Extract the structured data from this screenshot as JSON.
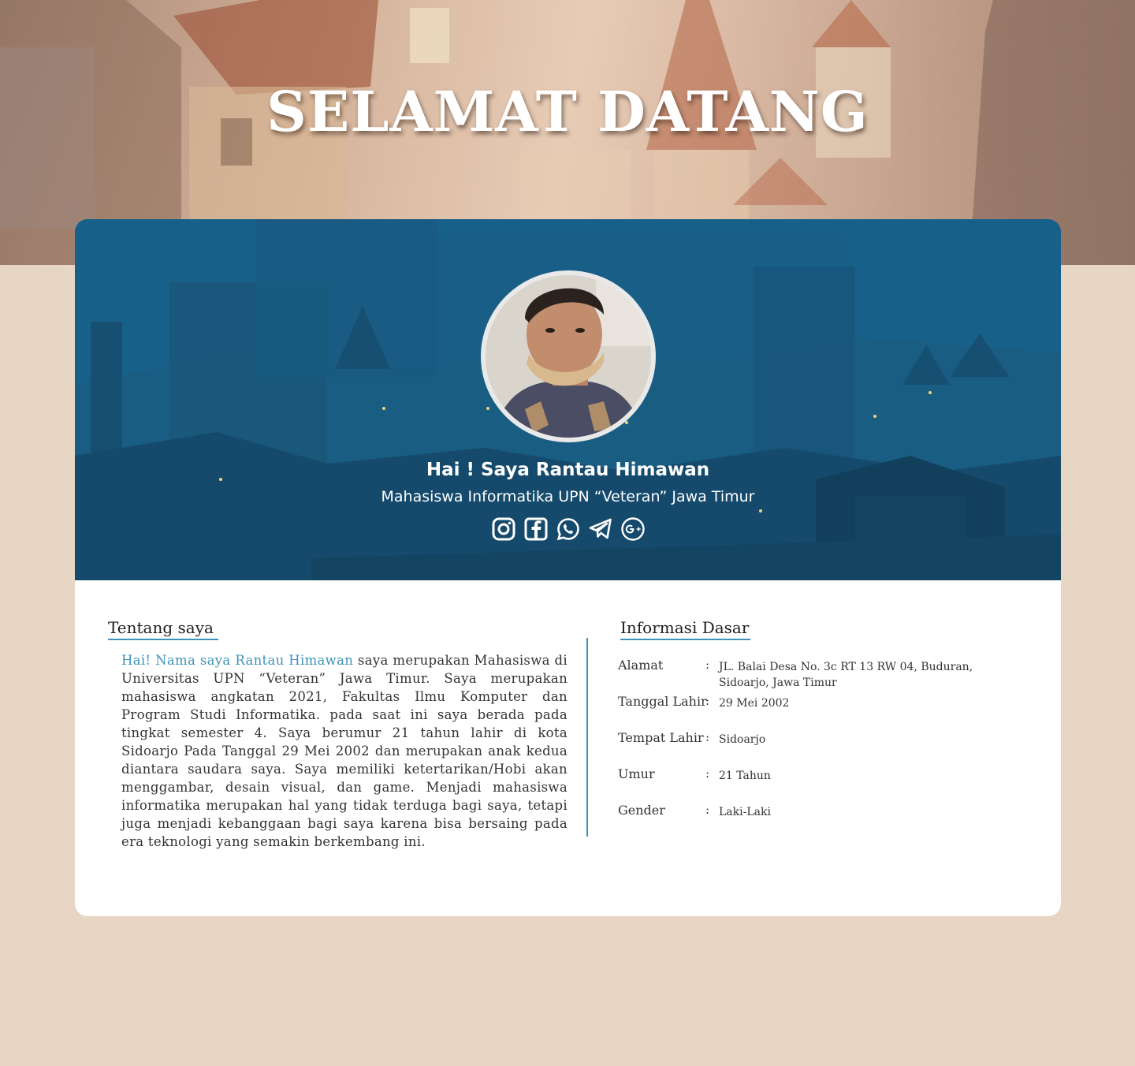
{
  "hero": {
    "title": "SELAMAT DATANG"
  },
  "profile": {
    "name": "Hai ! Saya Rantau Himawan",
    "role": "Mahasiswa Informatika UPN “Veteran” Jawa Timur",
    "socials": [
      {
        "icon": "instagram-icon"
      },
      {
        "icon": "facebook-icon"
      },
      {
        "icon": "whatsapp-icon"
      },
      {
        "icon": "telegram-icon"
      },
      {
        "icon": "google-plus-icon"
      }
    ]
  },
  "about": {
    "title": "Tentang saya",
    "highlight": "Hai! Nama saya Rantau Himawan",
    "text": " saya merupakan Mahasiswa di Universitas UPN “Veteran” Jawa Timur. Saya merupakan mahasiswa angkatan 2021, Fakultas Ilmu Komputer dan Program Studi Informatika. pada saat ini saya berada pada tingkat semester 4. Saya berumur 21 tahun lahir di kota Sidoarjo Pada Tanggal 29 Mei 2002 dan merupakan anak kedua diantara saudara saya. Saya memiliki ketertarikan/Hobi akan menggambar, desain visual, dan game. Menjadi mahasiswa informatika merupakan hal yang tidak terduga bagi saya, tetapi juga menjadi kebanggaan bagi saya karena bisa bersaing pada era teknologi yang semakin berkembang ini."
  },
  "info": {
    "title": "Informasi Dasar",
    "rows": [
      {
        "label": "Alamat",
        "value": "JL. Balai Desa No. 3c RT 13 RW 04, Buduran, Sidoarjo, Jawa Timur"
      },
      {
        "label": "Tanggal Lahir",
        "value": "29 Mei 2002"
      },
      {
        "label": "Tempat Lahir",
        "value": "Sidoarjo"
      },
      {
        "label": "Umur",
        "value": "21 Tahun"
      },
      {
        "label": "Gender",
        "value": "Laki-Laki"
      }
    ],
    "colon": ":"
  },
  "colors": {
    "accent": "#3f93b8",
    "page_bg": "#e8d6c4",
    "cover_bg": "#17608a"
  }
}
